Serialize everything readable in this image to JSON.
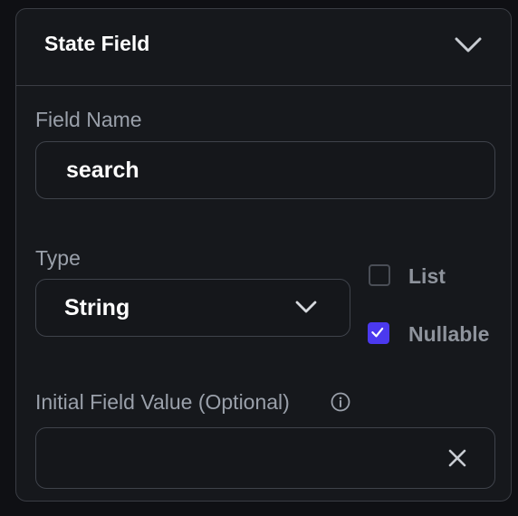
{
  "panel": {
    "title": "State Field",
    "chevron_icon": "chevron-down-icon"
  },
  "field_name": {
    "label": "Field Name",
    "value": "search"
  },
  "type": {
    "label": "Type",
    "selected": "String",
    "chevron_icon": "chevron-down-icon"
  },
  "options": {
    "list": {
      "label": "List",
      "checked": false
    },
    "nullable": {
      "label": "Nullable",
      "checked": true
    }
  },
  "initial_value": {
    "label": "Initial Field Value (Optional)",
    "value": "",
    "info_icon": "info-icon",
    "clear_icon": "close-icon"
  },
  "colors": {
    "accent": "#4b39ef",
    "background": "#16181c",
    "border": "#3a3d44"
  }
}
